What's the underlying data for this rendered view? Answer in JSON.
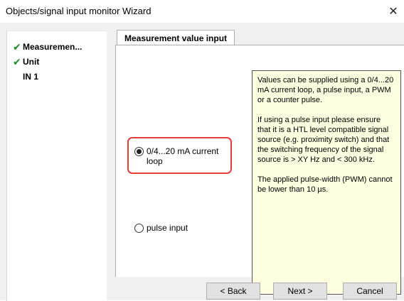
{
  "window": {
    "title": "Objects/signal input monitor Wizard",
    "close_glyph": "✕"
  },
  "steps": [
    {
      "label": "Measuremen...",
      "done": true
    },
    {
      "label": "Unit",
      "done": true
    },
    {
      "label": "IN 1",
      "done": false
    }
  ],
  "check_glyph": "✔",
  "tab": {
    "label": "Measurement value input"
  },
  "options": {
    "current_loop": {
      "label": "0/4...20 mA current loop",
      "selected": true
    },
    "pulse_input": {
      "label": "pulse input",
      "selected": false
    }
  },
  "info": {
    "paragraphs": [
      "Values can be supplied using a 0/4...20 mA current loop, a pulse input, a PWM or a counter pulse.",
      "If using a pulse input please ensure that it is a HTL level compatible signal source (e.g. proximity switch) and that the switching frequency of the signal source is > XY Hz and < 300 kHz.",
      "The applied pulse-width (PWM) cannot be lower than 10 µs."
    ]
  },
  "buttons": {
    "back": "< Back",
    "next": "Next >",
    "cancel": "Cancel"
  },
  "colors": {
    "highlight": "#e53b3b",
    "check": "#1d8c2a",
    "info_bg": "#ffffe1"
  }
}
